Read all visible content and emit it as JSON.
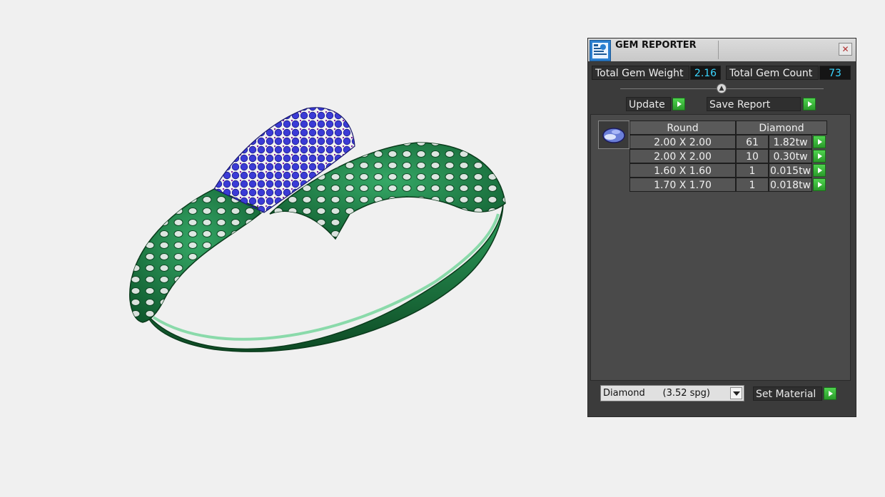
{
  "window": {
    "title": "GEM REPORTER",
    "close_symbol": "✕"
  },
  "summary": {
    "weight_label": "Total Gem Weight",
    "weight_value": "2.16",
    "count_label": "Total Gem Count",
    "count_value": "73"
  },
  "toolbar": {
    "update_label": "Update",
    "save_report_label": "Save Report"
  },
  "table": {
    "headers": [
      "Round",
      "Diamond"
    ],
    "rows": [
      {
        "size": "2.00 X 2.00",
        "count": "61",
        "weight": "1.82tw"
      },
      {
        "size": "2.00 X 2.00",
        "count": "10",
        "weight": "0.30tw"
      },
      {
        "size": "1.60 X 1.60",
        "count": "1",
        "weight": "0.015tw"
      },
      {
        "size": "1.70 X 1.70",
        "count": "1",
        "weight": "0.018tw"
      }
    ]
  },
  "material": {
    "selected": "Diamond      (3.52 spg)",
    "set_label": "Set Material"
  },
  "colors": {
    "ring": "#1f8a4a",
    "pave": "#3a3ad0",
    "accent_value": "#3ad6ff",
    "button_green": "#3cbf3c"
  },
  "icons": [
    "gem-reporter-app-icon",
    "close-icon",
    "collapse-arrow-icon",
    "play-arrow-icon",
    "diamond-gem-icon",
    "dropdown-arrow-icon"
  ]
}
